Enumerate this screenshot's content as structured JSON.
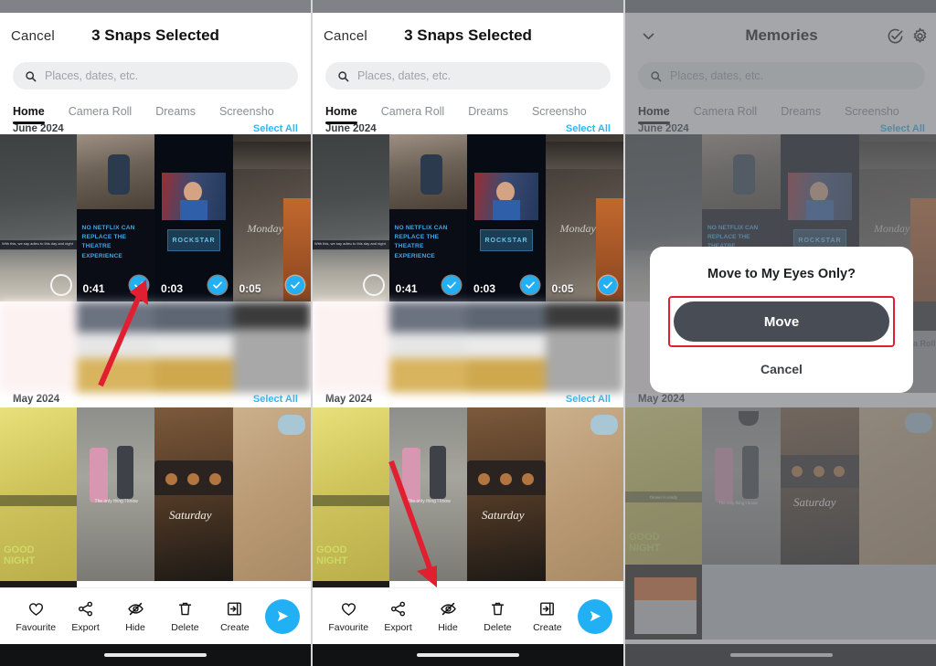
{
  "panels": [
    {
      "id": "panel-select",
      "header": {
        "cancel": "Cancel",
        "title": "3 Snaps Selected"
      },
      "search": {
        "placeholder": "Places, dates, etc."
      },
      "tabs": [
        {
          "label": "Home",
          "active": true
        },
        {
          "label": "Camera Roll",
          "active": false
        },
        {
          "label": "Dreams",
          "active": false
        },
        {
          "label": "Screensho",
          "active": false
        }
      ],
      "sections": [
        {
          "month": "June 2024",
          "select_all": "Select All"
        },
        {
          "month": "May 2024",
          "select_all": "Select All"
        }
      ],
      "thumbnails": [
        {
          "duration": "",
          "selected": false
        },
        {
          "duration": "0:41",
          "selected": true
        },
        {
          "duration": "0:03",
          "selected": true
        },
        {
          "duration": "0:05",
          "selected": true
        }
      ],
      "toolbar": [
        {
          "label": "Favourite",
          "icon": "heart-icon"
        },
        {
          "label": "Export",
          "icon": "share-icon"
        },
        {
          "label": "Hide",
          "icon": "eye-slash-icon"
        },
        {
          "label": "Delete",
          "icon": "trash-icon"
        },
        {
          "label": "Create",
          "icon": "create-icon"
        }
      ],
      "send_icon": "send-icon",
      "annotation": "arrow-pointing-to-selected-snap"
    },
    {
      "id": "panel-hide",
      "header": {
        "cancel": "Cancel",
        "title": "3 Snaps Selected"
      },
      "search": {
        "placeholder": "Places, dates, etc."
      },
      "tabs": [
        {
          "label": "Home",
          "active": true
        },
        {
          "label": "Camera Roll",
          "active": false
        },
        {
          "label": "Dreams",
          "active": false
        },
        {
          "label": "Screensho",
          "active": false
        }
      ],
      "sections": [
        {
          "month": "June 2024",
          "select_all": "Select All"
        },
        {
          "month": "May 2024",
          "select_all": "Select All"
        }
      ],
      "thumbnails": [
        {
          "duration": "",
          "selected": false
        },
        {
          "duration": "0:41",
          "selected": true
        },
        {
          "duration": "0:03",
          "selected": true
        },
        {
          "duration": "0:05",
          "selected": true
        }
      ],
      "toolbar": [
        {
          "label": "Favourite",
          "icon": "heart-icon"
        },
        {
          "label": "Export",
          "icon": "share-icon"
        },
        {
          "label": "Hide",
          "icon": "eye-slash-icon"
        },
        {
          "label": "Delete",
          "icon": "trash-icon"
        },
        {
          "label": "Create",
          "icon": "create-icon"
        }
      ],
      "send_icon": "send-icon",
      "annotation": "arrow-pointing-to-hide-button"
    },
    {
      "id": "panel-dialog",
      "header": {
        "chevron": "chevron-down-icon",
        "title": "Memories",
        "select_icon": "check-circle-icon",
        "settings_icon": "gear-icon"
      },
      "search": {
        "placeholder": "Places, dates, etc."
      },
      "tabs": [
        {
          "label": "Home",
          "active": true
        },
        {
          "label": "Camera Roll",
          "active": false
        },
        {
          "label": "Dreams",
          "active": false
        },
        {
          "label": "Screensho",
          "active": false
        }
      ],
      "sections": [
        {
          "month": "June 2024",
          "select_all": "Select All"
        },
        {
          "month": "May 2024",
          "select_all": "Select All"
        }
      ],
      "camera_roll_label": "From Camera Roll",
      "dialog": {
        "title": "Move to My Eyes Only?",
        "confirm": "Move",
        "cancel": "Cancel",
        "highlight_color": "#e02030"
      }
    }
  ],
  "colors": {
    "accent_blue": "#22b0f4",
    "dark_button": "#474c55",
    "highlight_red": "#e02030",
    "tab_active": "#111111",
    "link_blue": "#2fb6f5"
  }
}
